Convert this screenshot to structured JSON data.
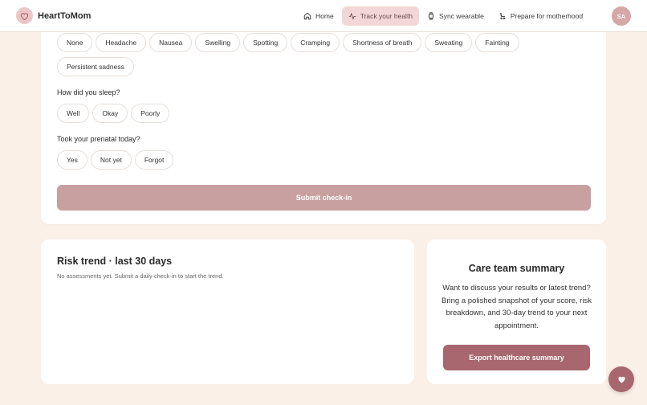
{
  "header": {
    "brand": "HeartToMom",
    "logo_icon": "heart-icon",
    "nav": [
      {
        "label": "Home",
        "icon": "home-icon",
        "active": false
      },
      {
        "label": "Track your health",
        "icon": "activity-icon",
        "active": true
      },
      {
        "label": "Sync wearable",
        "icon": "watch-icon",
        "active": false
      },
      {
        "label": "Prepare for motherhood",
        "icon": "stroller-icon",
        "active": false
      }
    ],
    "avatar_initials": "SA"
  },
  "checkin": {
    "symptoms": [
      "None",
      "Headache",
      "Nausea",
      "Swelling",
      "Spotting",
      "Cramping",
      "Shortness of breath",
      "Sweating",
      "Fainting",
      "Persistent sadness"
    ],
    "sleep_question": "How did you sleep?",
    "sleep_options": [
      "Well",
      "Okay",
      "Poorly"
    ],
    "prenatal_question": "Took your prenatal today?",
    "prenatal_options": [
      "Yes",
      "Not yet",
      "Forgot"
    ],
    "submit_label": "Submit check-in"
  },
  "risk_trend": {
    "title": "Risk trend · last 30 days",
    "empty_message": "No assessments yet. Submit a daily check-in to start the trend."
  },
  "care_team": {
    "title": "Care team summary",
    "body": "Want to discuss your results or latest trend? Bring a polished snapshot of your score, risk breakdown, and 30-day trend to your next appointment.",
    "export_label": "Export healthcare summary"
  },
  "fab_icon": "heart-icon",
  "colors": {
    "background": "#fbf0e8",
    "accent": "#a8676e",
    "submit_disabled": "#c9a0a0",
    "nav_active_bg": "#f3d6d6"
  }
}
